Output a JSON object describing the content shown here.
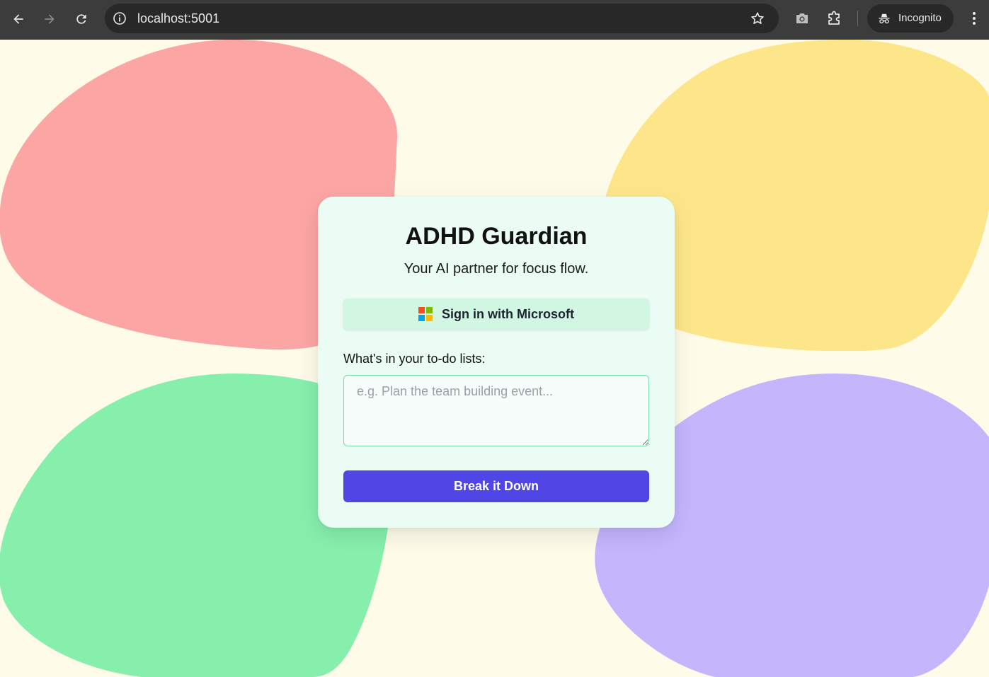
{
  "browser": {
    "url": "localhost:5001",
    "incognito_label": "Incognito"
  },
  "card": {
    "title": "ADHD Guardian",
    "subtitle": "Your AI partner for focus flow.",
    "microsoft_button_label": "Sign in with Microsoft",
    "todo_label": "What's in your to-do lists:",
    "todo_placeholder": "e.g. Plan the team building event...",
    "todo_value": "",
    "submit_label": "Break it Down"
  },
  "colors": {
    "page_background": "#fefbe9",
    "blob_red": "#fca5a5",
    "blob_yellow": "#fde68a",
    "blob_green": "#86efac",
    "blob_purple": "#c4b5fd",
    "card_background": "#eafcf3",
    "primary_button": "#4f46e5",
    "microsoft_red": "#f25022",
    "microsoft_green": "#7fba00",
    "microsoft_blue": "#00a4ef",
    "microsoft_yellow": "#ffb900"
  },
  "icons": [
    "back-arrow-icon",
    "forward-arrow-icon",
    "reload-icon",
    "site-info-icon",
    "bookmark-star-icon",
    "camera-icon",
    "extensions-icon",
    "incognito-icon",
    "more-menu-icon",
    "microsoft-logo-icon"
  ]
}
